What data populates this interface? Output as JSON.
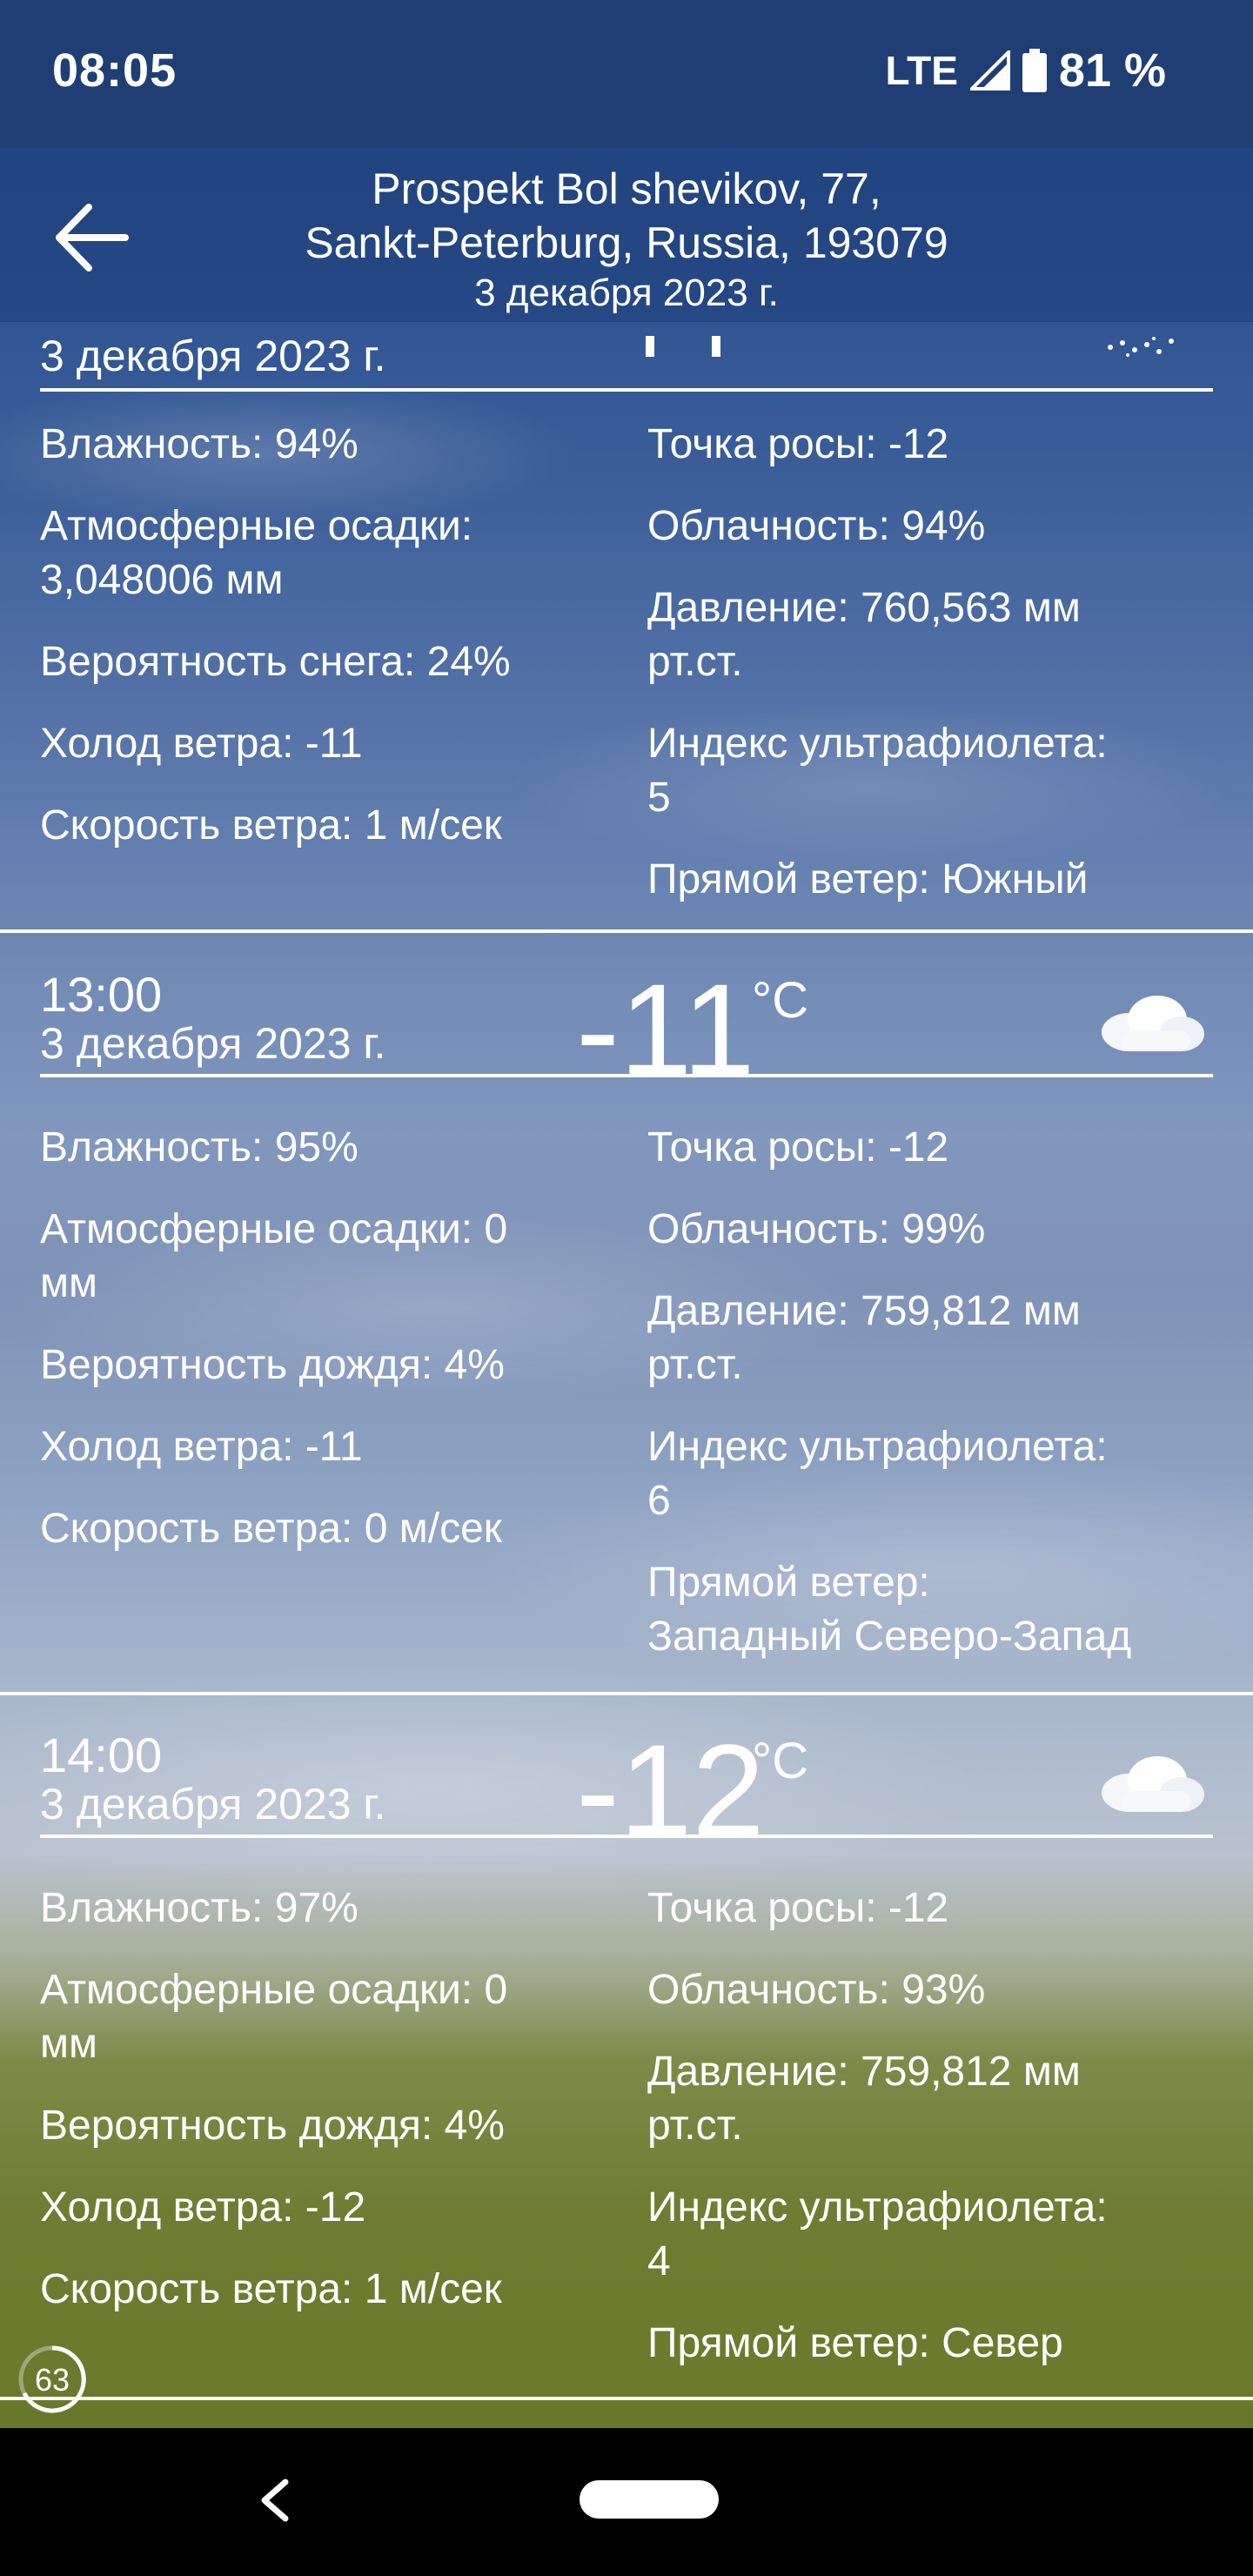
{
  "status_bar": {
    "time": "08:05",
    "network": "LTE",
    "battery": "81 %"
  },
  "header": {
    "address_line1": "Prospekt Bol shevikov, 77,",
    "address_line2": "Sankt-Peterburg, Russia, 193079",
    "date": "3 декабря 2023 г."
  },
  "first_block": {
    "date": "3 декабря 2023 г.",
    "left": [
      "Влажность: 94%",
      "Атмосферные осадки:",
      "3,048006 мм",
      "Вероятность снега: 24%",
      "Холод ветра: -11",
      "Скорость ветра: 1 м/сек"
    ],
    "right": [
      "Точка росы: -12",
      "Облачность: 94%",
      "Давление: 760,563 мм",
      "рт.ст.",
      "Индекс ультрафиолета:",
      "5",
      "Прямой ветер: Южный"
    ]
  },
  "block_13": {
    "time": "13:00",
    "temp": "-11",
    "unit": "°C",
    "date": "3 декабря 2023 г.",
    "left": [
      "Влажность: 95%",
      "Атмосферные осадки: 0",
      "мм",
      "Вероятность дождя: 4%",
      "Холод ветра: -11",
      "Скорость ветра: 0 м/сек"
    ],
    "right": [
      "Точка росы: -12",
      "Облачность: 99%",
      "Давление: 759,812 мм",
      "рт.ст.",
      "Индекс ультрафиолета:",
      "6",
      "Прямой ветер:",
      "Западный Северо-Запад"
    ]
  },
  "block_14": {
    "time": "14:00",
    "temp": "-12",
    "unit": "°C",
    "date": "3 декабря 2023 г.",
    "left": [
      "Влажность: 97%",
      "Атмосферные осадки: 0",
      "мм",
      "Вероятность дождя: 4%",
      "Холод ветра: -12",
      "Скорость ветра: 1 м/сек"
    ],
    "right": [
      "Точка росы: -12",
      "Облачность: 93%",
      "Давление: 759,812 мм",
      "рт.ст.",
      "Индекс ультрафиолета:",
      "4",
      "Прямой ветер: Север"
    ]
  },
  "badge": "63",
  "icons": {
    "back": "arrow-left-icon",
    "weather": "cloud-icon",
    "nav_back": "chevron-left-icon"
  }
}
